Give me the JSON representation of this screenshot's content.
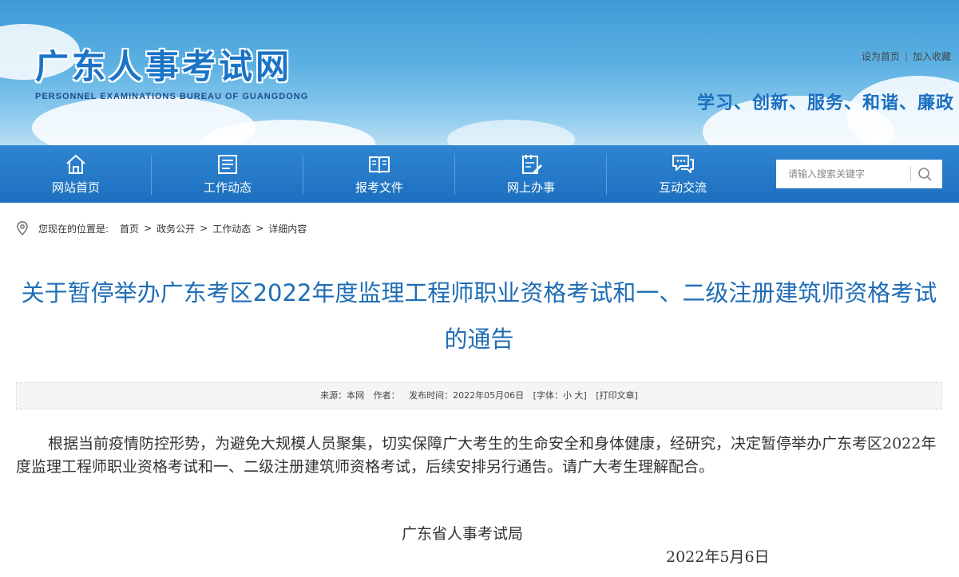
{
  "header": {
    "site_title": "广东人事考试网",
    "site_subtitle": "PERSONNEL EXAMINATIONS BUREAU OF GUANGDONG",
    "links": [
      "设为首页",
      "加入收藏"
    ],
    "link_separator": "|",
    "slogan": "学习、创新、服务、和谐、廉政"
  },
  "nav": {
    "items": [
      {
        "label": "网站首页",
        "icon": "home-icon"
      },
      {
        "label": "工作动态",
        "icon": "news-icon"
      },
      {
        "label": "报考文件",
        "icon": "book-icon"
      },
      {
        "label": "网上办事",
        "icon": "edit-form-icon"
      },
      {
        "label": "互动交流",
        "icon": "chat-icon"
      }
    ],
    "search_placeholder": "请输入搜索关键字"
  },
  "breadcrumb": {
    "prefix": "您现在的位置是:",
    "items": [
      "首页",
      "政务公开",
      "工作动态",
      "详细内容"
    ],
    "arrow": ">"
  },
  "article": {
    "title": "关于暂停举办广东考区2022年度监理工程师职业资格考试和一、二级注册建筑师资格考试的通告",
    "meta": {
      "source": "来源：本网",
      "author": "作者：",
      "date": "发布时间：2022年05月06日",
      "font_size": "[字体：小 大]",
      "print": "[打印文章]"
    },
    "body": "根据当前疫情防控形势，为避免大规模人员聚集，切实保障广大考生的生命安全和身体健康，经研究，决定暂停举办广东考区2022年度监理工程师职业资格考试和一、二级注册建筑师资格考试，后续安排另行通告。请广大考生理解配合。",
    "signature": "广东省人事考试局",
    "sign_date": "2022年5月6日"
  },
  "colors": {
    "nav_bg": "#1d6fbf",
    "title_blue": "#1f6db5",
    "slogan_blue": "#1a6fc0"
  }
}
